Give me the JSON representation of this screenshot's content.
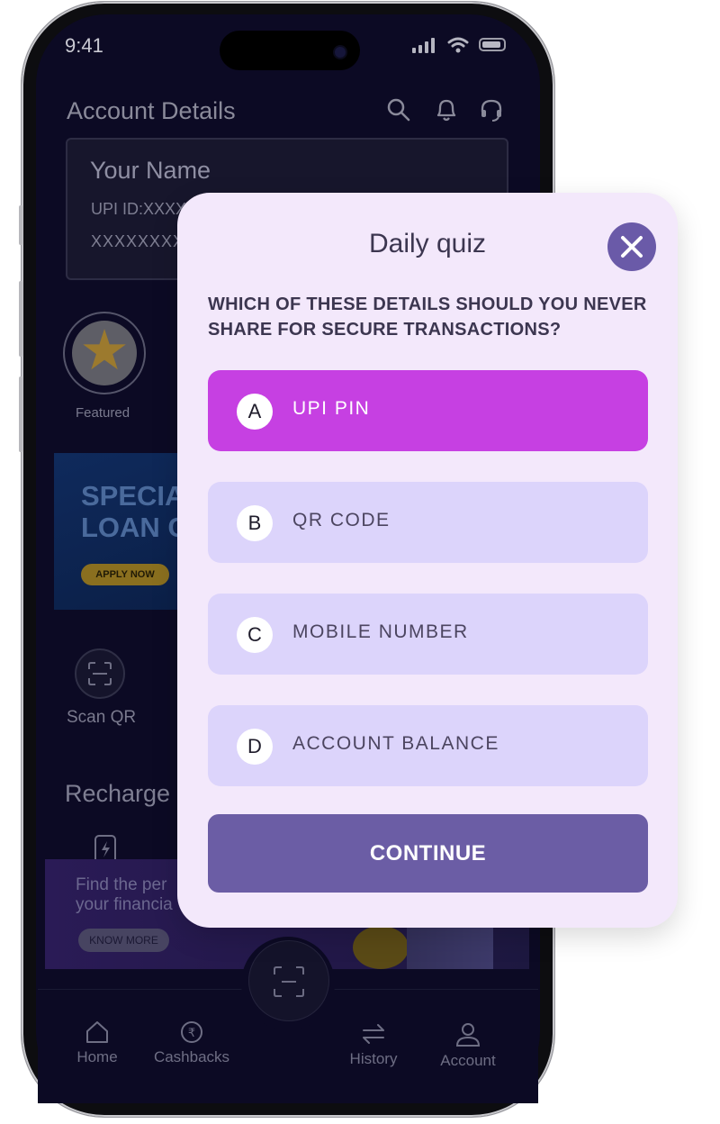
{
  "status_bar": {
    "time": "9:41"
  },
  "header": {
    "title": "Account Details"
  },
  "account_card": {
    "name": "Your Name",
    "upi": "UPI ID:XXXX",
    "account": "XXXXXXXX"
  },
  "featured": {
    "label": "Featured"
  },
  "loan_banner": {
    "text_line1": "SPECIA",
    "text_line2": "LOAN C",
    "button": "APPLY NOW"
  },
  "scan": {
    "label": "Scan QR"
  },
  "recharge": {
    "title": "Recharge"
  },
  "promo_banner": {
    "line1": "Find the per",
    "line2": "your financia",
    "button": "KNOW MORE"
  },
  "bottom_nav": {
    "items": [
      {
        "label": "Home",
        "icon": "home-icon"
      },
      {
        "label": "Cashbacks",
        "icon": "cashback-icon"
      },
      {
        "label": "History",
        "icon": "history-icon"
      },
      {
        "label": "Account",
        "icon": "account-icon"
      }
    ]
  },
  "quiz": {
    "title": "Daily quiz",
    "question": "WHICH OF THESE DETAILS SHOULD YOU NEVER SHARE FOR SECURE TRANSACTIONS?",
    "options": [
      {
        "letter": "A",
        "label": "UPI PIN",
        "selected": true
      },
      {
        "letter": "B",
        "label": "QR CODE",
        "selected": false
      },
      {
        "letter": "C",
        "label": "MOBILE NUMBER",
        "selected": false
      },
      {
        "letter": "D",
        "label": "ACCOUNT BALANCE",
        "selected": false
      }
    ],
    "continue_label": "CONTINUE"
  },
  "colors": {
    "modal_bg": "#f3e8fb",
    "selected_option": "#c640e2",
    "option_bg": "#dcd4fb",
    "primary_button": "#6b5da5",
    "close_button": "#6a5aa8"
  }
}
